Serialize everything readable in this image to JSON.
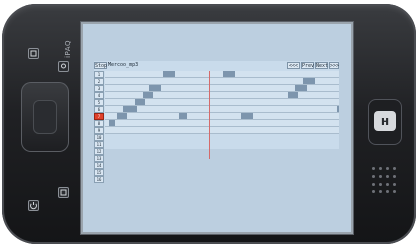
{
  "device": {
    "brand": "iPAQ",
    "logo_icon": "hp-logo-icon"
  },
  "app": {
    "toolbar": {
      "stop_label": "Stop",
      "filename": "Mercoo_mp3",
      "back_label": "<<<",
      "prev_label": "Prev",
      "next_label": "Next",
      "forward_label": ">>>"
    },
    "rows": [
      "1",
      "2",
      "3",
      "4",
      "5",
      "6",
      "7",
      "8",
      "9",
      "10",
      "11",
      "12",
      "13",
      "14",
      "15",
      "16"
    ],
    "active_row": "7",
    "colors": {
      "screen_bg": "#bccfe0",
      "track_bg": "#d3e2ef",
      "note": "#7d95ad",
      "active_row": "#e0402a",
      "playhead": "#d46b6b"
    }
  }
}
